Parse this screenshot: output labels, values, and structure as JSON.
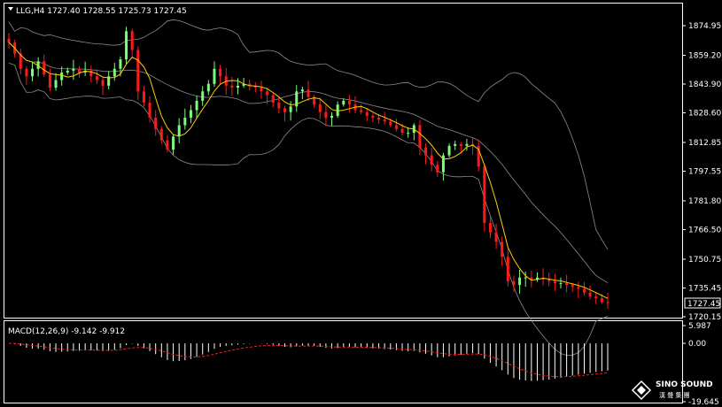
{
  "header": {
    "symbol_label": "LLG,H4",
    "open": "1727.40",
    "high": "1728.55",
    "low": "1725.73",
    "close": "1727.45"
  },
  "price_axis": {
    "ticks": [
      "1874.95",
      "1859.20",
      "1843.90",
      "1828.60",
      "1812.85",
      "1797.55",
      "1781.80",
      "1766.50",
      "1750.75",
      "1735.45",
      "1720.15"
    ],
    "current_price": "1727.45"
  },
  "macd_panel": {
    "label": "MACD(12,26,9) -9.142 -9.912",
    "ticks": [
      "5.987",
      "0.00",
      "-19.645"
    ]
  },
  "logo": {
    "brand": "SINO SOUND",
    "subtitle": "漢 聲 集 團"
  },
  "colors": {
    "bull": "#7CFC7C",
    "bear": "#FF1A1A",
    "bands": "#8C8C8C",
    "ma": "#FFD000",
    "macd_hist": "#FFFFFF",
    "signal": "#FF1A1A",
    "grid": "#FFFFFF"
  },
  "chart_data": [
    {
      "type": "candlestick",
      "title": "LLG,H4",
      "timeframe": "H4",
      "ylim": [
        1720.15,
        1874.95
      ],
      "grid": false,
      "indicators": [
        "Bollinger Bands",
        "Moving Average"
      ],
      "close_path": [
        1866,
        1860,
        1852,
        1848,
        1852,
        1856,
        1849,
        1842,
        1846,
        1850,
        1851,
        1852,
        1850,
        1851,
        1848,
        1846,
        1843,
        1848,
        1852,
        1857,
        1872,
        1862,
        1840,
        1834,
        1826,
        1820,
        1814,
        1809,
        1816,
        1822,
        1826,
        1830,
        1835,
        1840,
        1844,
        1852,
        1848,
        1843,
        1842,
        1843,
        1844,
        1843,
        1842,
        1840,
        1838,
        1834,
        1831,
        1829,
        1832,
        1840,
        1841,
        1837,
        1833,
        1829,
        1826,
        1827,
        1833,
        1835,
        1833,
        1830,
        1829,
        1827,
        1826,
        1825,
        1824,
        1822,
        1820,
        1818,
        1818,
        1822,
        1810,
        1806,
        1801,
        1797,
        1806,
        1811,
        1812,
        1811,
        1812,
        1811,
        1800,
        1770,
        1765,
        1760,
        1752,
        1739,
        1737,
        1741,
        1741,
        1740,
        1741,
        1740,
        1739,
        1738,
        1738,
        1737,
        1736,
        1735,
        1733,
        1731,
        1730,
        1728,
        1727.45
      ]
    },
    {
      "type": "bar",
      "title": "MACD(12,26,9) -9.142 -9.912",
      "series": [
        {
          "name": "MACD",
          "value": -9.142
        },
        {
          "name": "Signal",
          "value": -9.912
        }
      ],
      "ylim": [
        -19.645,
        5.987
      ]
    }
  ]
}
